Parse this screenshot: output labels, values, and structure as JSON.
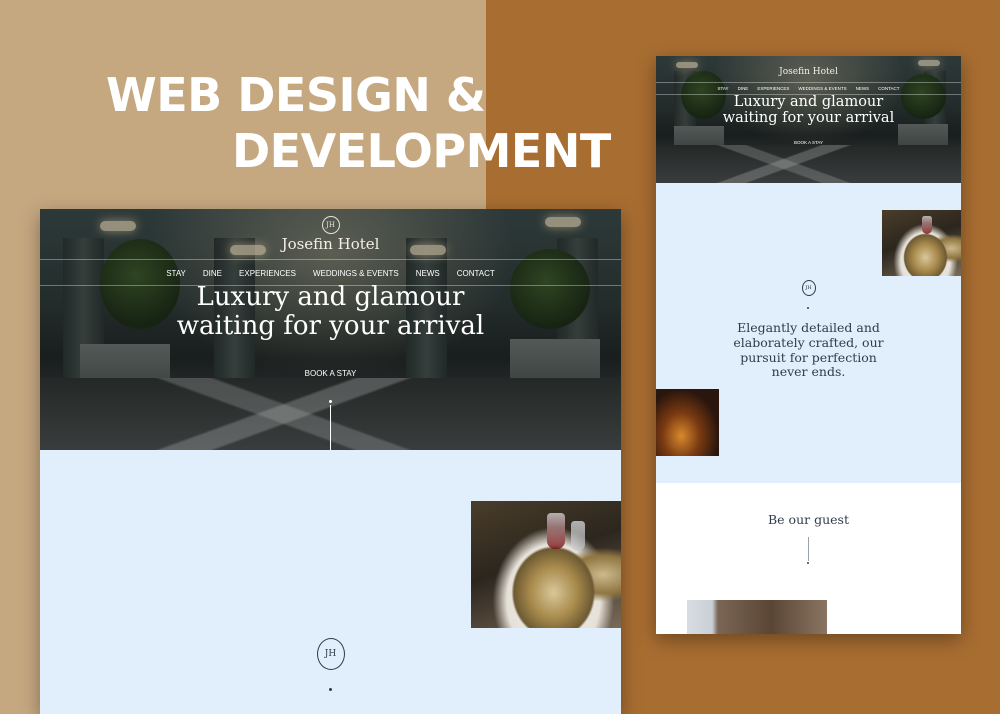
{
  "headline": {
    "line1": "WEB DESIGN &",
    "line2": "DEVELOPMENT"
  },
  "site": {
    "hotel_name": "Josefin Hotel",
    "logo_monogram": "JH",
    "nav": [
      "STAY",
      "DINE",
      "EXPERIENCES",
      "WEDDINGS & EVENTS",
      "NEWS",
      "CONTACT"
    ],
    "hero_title_line1": "Luxury and glamour",
    "hero_title_line2": "waiting for your arrival",
    "hero_button": "BOOK A STAY",
    "tagline_line1": "Elegantly detailed and",
    "tagline_line2": "elaborately crafted, our",
    "tagline_line3": "pursuit for perfection",
    "tagline_line4": "never ends.",
    "guest_heading": "Be our guest"
  },
  "colors": {
    "bg_left": "#c5a880",
    "bg_right": "#a86d31",
    "section_blue": "#e1effc",
    "text_dark": "#2f3b4a"
  }
}
